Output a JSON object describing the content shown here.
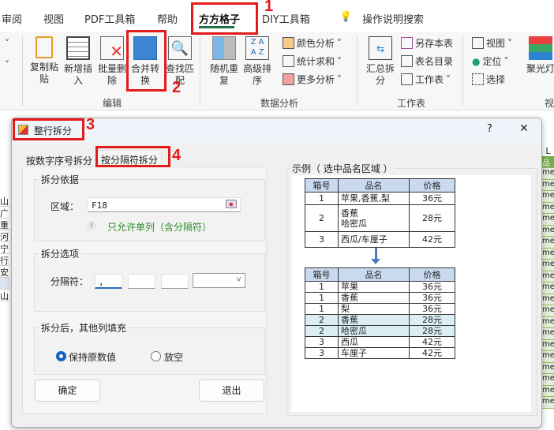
{
  "ribbon_tabs": [
    "审阅",
    "视图",
    "PDF工具箱",
    "帮助",
    "方方格子",
    "DIY工具箱",
    "操作说明搜索"
  ],
  "ribbon": {
    "edit": {
      "label": "编辑",
      "buttons": [
        "复制粘贴",
        "新增插入",
        "批量删除",
        "合并转换",
        "查找匹配"
      ]
    },
    "analysis": {
      "label": "数据分析",
      "buttons": [
        "随机重复",
        "高级排序"
      ],
      "small": [
        "颜色分析",
        "统计求和",
        "更多分析"
      ]
    },
    "sheet": {
      "label": "工作表",
      "buttons": [
        "汇总拆分"
      ],
      "small": [
        "另存本表",
        "表名目录",
        "工作表"
      ]
    },
    "view": {
      "label": "视",
      "small": [
        "视图",
        "定位",
        "选择"
      ],
      "buttons": [
        "聚光灯"
      ]
    }
  },
  "annotations": [
    "1",
    "2",
    "3",
    "4"
  ],
  "dialog": {
    "title": "整行拆分",
    "help": "?",
    "close": "✕",
    "tabs": [
      "按数字序号拆分",
      "按分隔符拆分"
    ],
    "basis": {
      "title": "拆分依据",
      "area_label": "区域：",
      "area_value": "F18",
      "hint": "只允许单列（含分隔符）"
    },
    "options": {
      "title": "拆分选项",
      "sep_label": "分隔符：",
      "sep1": ",",
      "sep2": "",
      "sep3": "",
      "sep_select": ""
    },
    "fill": {
      "title": "拆分后，其他列填充",
      "keep": "保持原数值",
      "empty": "放空",
      "selected": "keep"
    },
    "ok": "确定",
    "exit": "退出",
    "example": {
      "title": "示例（ 选中品名区域 ）",
      "headers": [
        "箱号",
        "品名",
        "价格"
      ],
      "before": [
        [
          "1",
          "苹果,香蕉,梨",
          "36元"
        ],
        [
          "2",
          "香蕉\n哈密瓜",
          "28元"
        ],
        [
          "3",
          "西瓜/车厘子",
          "42元"
        ]
      ],
      "after": [
        [
          "1",
          "苹果",
          "36元"
        ],
        [
          "1",
          "香蕉",
          "36元"
        ],
        [
          "1",
          "梨",
          "36元"
        ],
        [
          "2",
          "香蕉",
          "28元"
        ],
        [
          "2",
          "哈密瓜",
          "28元"
        ],
        [
          "3",
          "西瓜",
          "42元"
        ],
        [
          "3",
          "车厘子",
          "42元"
        ]
      ],
      "highlight_color": "#daeef3"
    }
  },
  "sheet": {
    "left_cells": [
      "山",
      "广",
      "重",
      "河",
      "宁",
      "行",
      "安",
      "",
      "山"
    ],
    "right_header": "L",
    "right_first": "品名",
    "right_cell": "me"
  }
}
